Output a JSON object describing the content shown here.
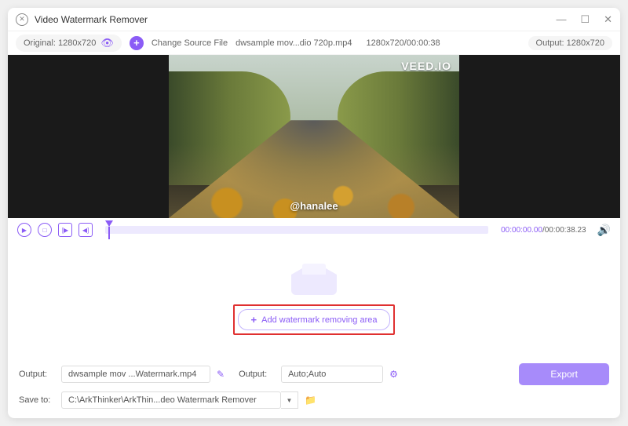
{
  "title": "Video Watermark Remover",
  "topbar": {
    "original_label": "Original: 1280x720",
    "change_source": "Change Source File",
    "filename": "dwsample mov...dio 720p.mp4",
    "resolution_time": "1280x720/00:00:38",
    "output_label": "Output: 1280x720"
  },
  "preview": {
    "logo": "VEED.IO",
    "handle": "@hanalee"
  },
  "timeline": {
    "current": "00:00:00.00",
    "total": "00:00:38.23"
  },
  "add_area": "Add watermark removing area",
  "bottom": {
    "output_label": "Output:",
    "output_file": "dwsample mov ...Watermark.mp4",
    "output_label2": "Output:",
    "output_auto": "Auto;Auto",
    "save_label": "Save to:",
    "save_path": "C:\\ArkThinker\\ArkThin...deo Watermark Remover",
    "export": "Export"
  }
}
